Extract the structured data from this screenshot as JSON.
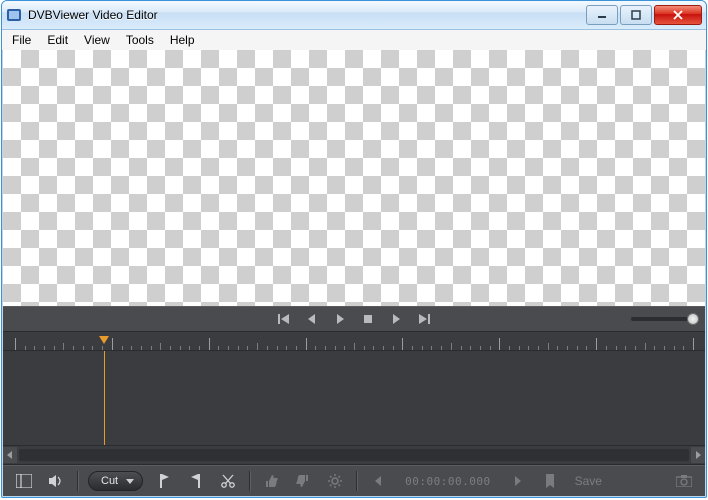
{
  "window": {
    "title": "DVBViewer Video Editor"
  },
  "menu": {
    "items": [
      "File",
      "Edit",
      "View",
      "Tools",
      "Help"
    ]
  },
  "transport": {
    "icons": [
      "go-start",
      "step-back",
      "play",
      "stop",
      "step-forward",
      "go-end"
    ]
  },
  "timeline": {
    "playhead_percent": 13.2,
    "zoom_percent": 100
  },
  "bottom": {
    "mode_label": "Cut",
    "timecode": "00:00:00.000",
    "save_label": "Save",
    "icons_left": [
      "project-panel",
      "audio-mute"
    ],
    "icons_edit": [
      "flag-in",
      "flag-out",
      "scissors"
    ],
    "icons_mark": [
      "thumb-up",
      "thumb-down",
      "cog"
    ],
    "icons_nav": [
      "prev-marker",
      "next-marker",
      "bookmark"
    ]
  }
}
